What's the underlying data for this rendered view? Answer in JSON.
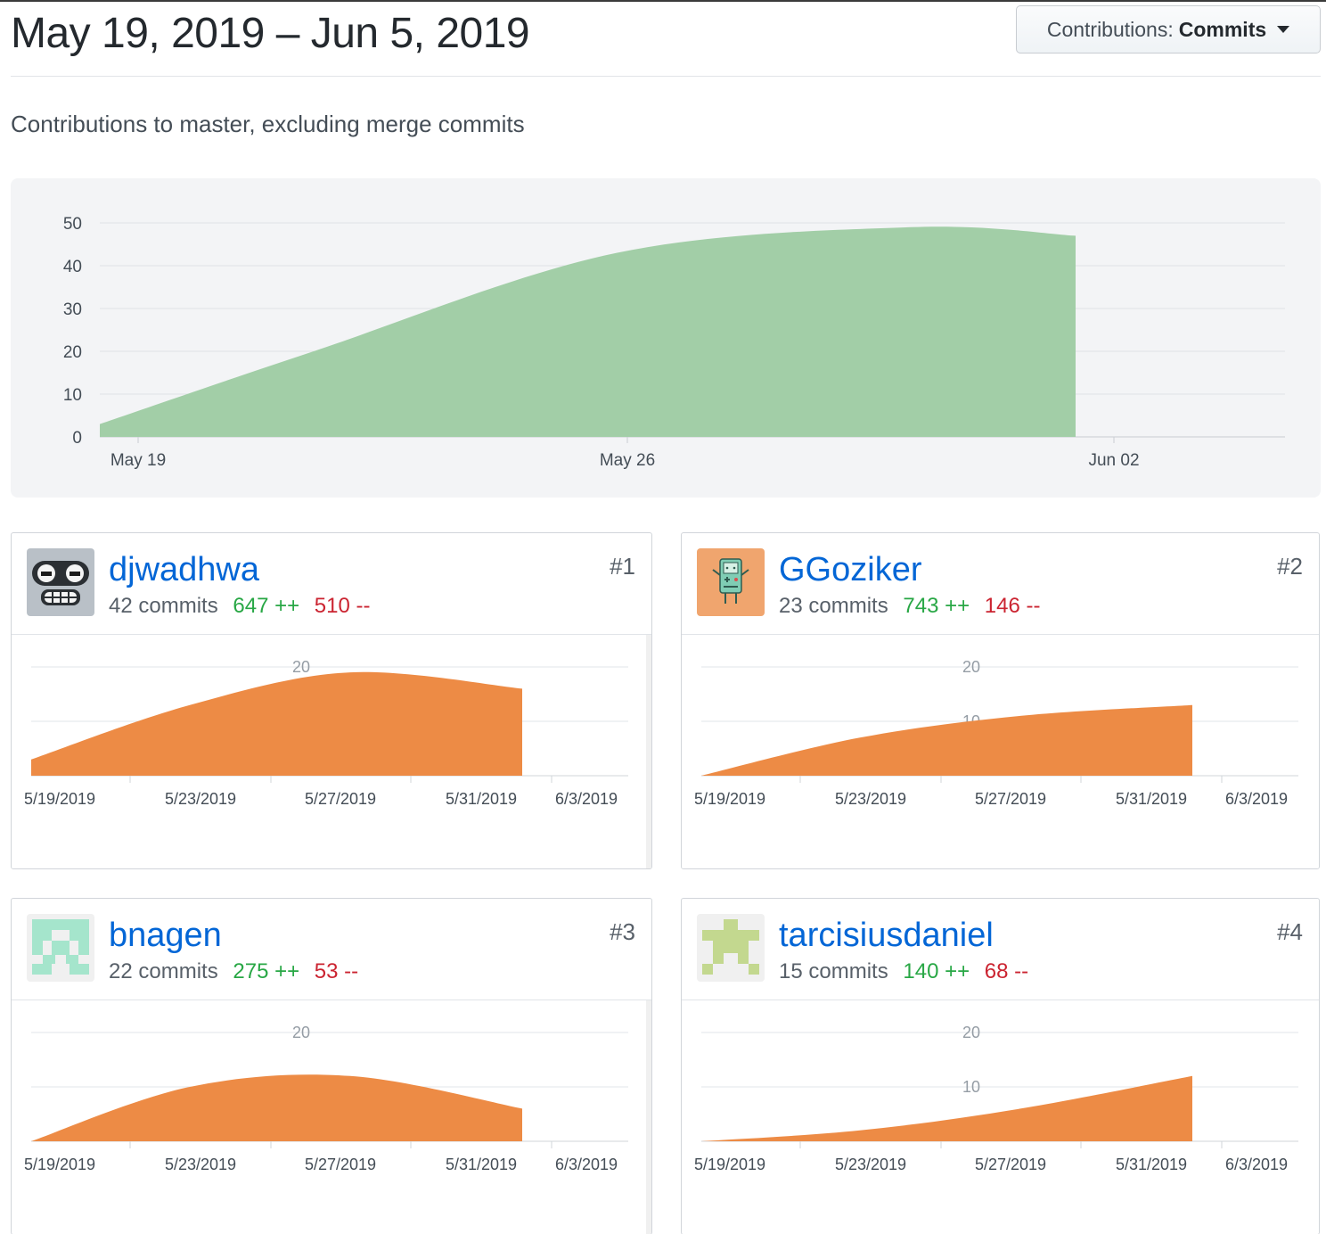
{
  "header": {
    "date_range": "May 19, 2019 – Jun 5, 2019",
    "dropdown_label": "Contributions:",
    "dropdown_value": "Commits"
  },
  "subtitle": "Contributions to master, excluding merge commits",
  "colors": {
    "main_area": "#a2cea7",
    "contributor_area": "#ed8b45",
    "link": "#0366d6",
    "additions": "#28a745",
    "deletions": "#cb2431"
  },
  "chart_data": [
    {
      "type": "area",
      "title": "",
      "x": [
        "2019-05-19",
        "2019-05-22",
        "2019-05-26",
        "2019-05-30",
        "2019-06-01"
      ],
      "x_ticks": [
        "May 19",
        "May 26",
        "Jun 02"
      ],
      "y_ticks": [
        "0",
        "10",
        "20",
        "30",
        "40",
        "50"
      ],
      "series": [
        {
          "values": [
            3,
            20,
            43,
            49,
            47
          ]
        }
      ],
      "ylim": [
        0,
        50
      ],
      "grid": true
    },
    {
      "type": "area",
      "title": "djwadhwa",
      "x_ticks": [
        "5/19/2019",
        "5/23/2019",
        "5/27/2019",
        "5/31/2019",
        "6/3/2019"
      ],
      "y_ticks": [
        "20"
      ],
      "series": [
        {
          "values": [
            3,
            13,
            19,
            16
          ]
        }
      ],
      "ylim": [
        0,
        20
      ],
      "grid": true
    },
    {
      "type": "area",
      "title": "GGoziker",
      "x_ticks": [
        "5/19/2019",
        "5/23/2019",
        "5/27/2019",
        "5/31/2019",
        "6/3/2019"
      ],
      "y_ticks": [
        "20",
        "10"
      ],
      "series": [
        {
          "values": [
            0,
            7,
            11,
            13
          ]
        }
      ],
      "ylim": [
        0,
        20
      ],
      "grid": true
    },
    {
      "type": "area",
      "title": "bnagen",
      "x_ticks": [
        "5/19/2019",
        "5/23/2019",
        "5/27/2019",
        "5/31/2019",
        "6/3/2019"
      ],
      "y_ticks": [
        "20"
      ],
      "series": [
        {
          "values": [
            0,
            10,
            12,
            6
          ]
        }
      ],
      "ylim": [
        0,
        20
      ],
      "grid": true
    },
    {
      "type": "area",
      "title": "tarcisiusdaniel",
      "x_ticks": [
        "5/19/2019",
        "5/23/2019",
        "5/27/2019",
        "5/31/2019",
        "6/3/2019"
      ],
      "y_ticks": [
        "20",
        "10"
      ],
      "series": [
        {
          "values": [
            0,
            2,
            6,
            12
          ]
        }
      ],
      "ylim": [
        0,
        20
      ],
      "grid": true
    }
  ],
  "contributors": [
    {
      "name": "djwadhwa",
      "commits": "42 commits",
      "additions": "647 ++",
      "deletions": "510 --",
      "rank": "#1",
      "avatar": "robot-avatar-icon"
    },
    {
      "name": "GGoziker",
      "commits": "23 commits",
      "additions": "743 ++",
      "deletions": "146 --",
      "rank": "#2",
      "avatar": "game-console-avatar-icon"
    },
    {
      "name": "bnagen",
      "commits": "22 commits",
      "additions": "275 ++",
      "deletions": "53 --",
      "rank": "#3",
      "avatar": "identicon-teal-icon"
    },
    {
      "name": "tarcisiusdaniel",
      "commits": "15 commits",
      "additions": "140 ++",
      "deletions": "68 --",
      "rank": "#4",
      "avatar": "identicon-green-icon"
    }
  ]
}
